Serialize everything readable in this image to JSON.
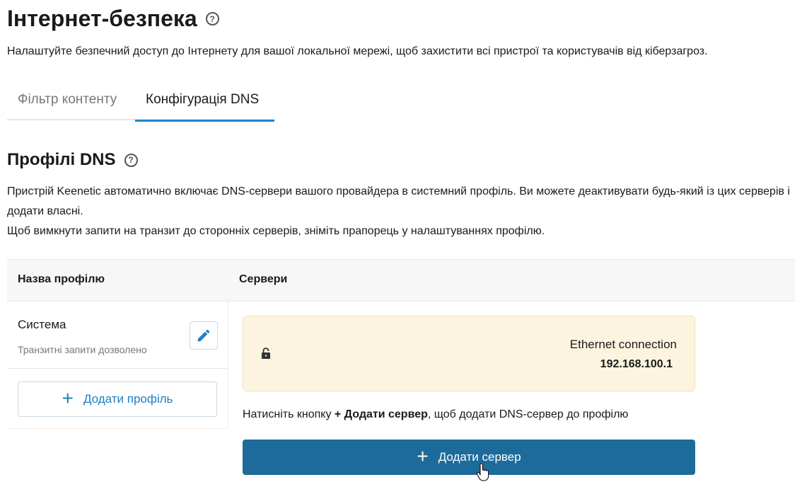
{
  "page": {
    "title": "Інтернет-безпека",
    "help_icon": "question-circle-icon",
    "description": "Налаштуйте безпечний доступ до Інтернету для вашої локальної мережі, щоб захистити всі пристрої та користувачів від кіберзагроз."
  },
  "tabs": [
    {
      "label": "Фільтр контенту",
      "active": false
    },
    {
      "label": "Конфігурація DNS",
      "active": true
    }
  ],
  "dns_profiles": {
    "title": "Профілі DNS",
    "help_icon": "question-circle-icon",
    "description_line1": "Пристрій Keenetic автоматично включає DNS-сервери вашого провайдера в системний профіль. Ви можете деактивувати будь-який із цих серверів і додати власні.",
    "description_line2": "Щоб вимкнути запити на транзит до сторонніх серверів, зніміть прапорець у налаштуваннях профілю.",
    "table": {
      "col_profile": "Назва профілю",
      "col_servers": "Сервери"
    },
    "profiles": [
      {
        "name": "Система",
        "subtitle": "Транзитні запити дозволено",
        "edit_icon": "pencil-icon"
      }
    ],
    "add_profile_label": "Додати профіль",
    "servers": [
      {
        "name": "Ethernet connection",
        "ip": "192.168.100.1",
        "icon": "lock-icon"
      }
    ],
    "hint_prefix": "Натисніть кнопку ",
    "hint_bold": "+ Додати сервер",
    "hint_suffix": ", щоб додати DNS-сервер до профілю",
    "add_server_label": "Додати сервер"
  },
  "colors": {
    "accent": "#1e88d0",
    "primary_button": "#1d6b9a",
    "server_card_bg": "#fdf4df",
    "link_text": "#1e7fc0"
  }
}
